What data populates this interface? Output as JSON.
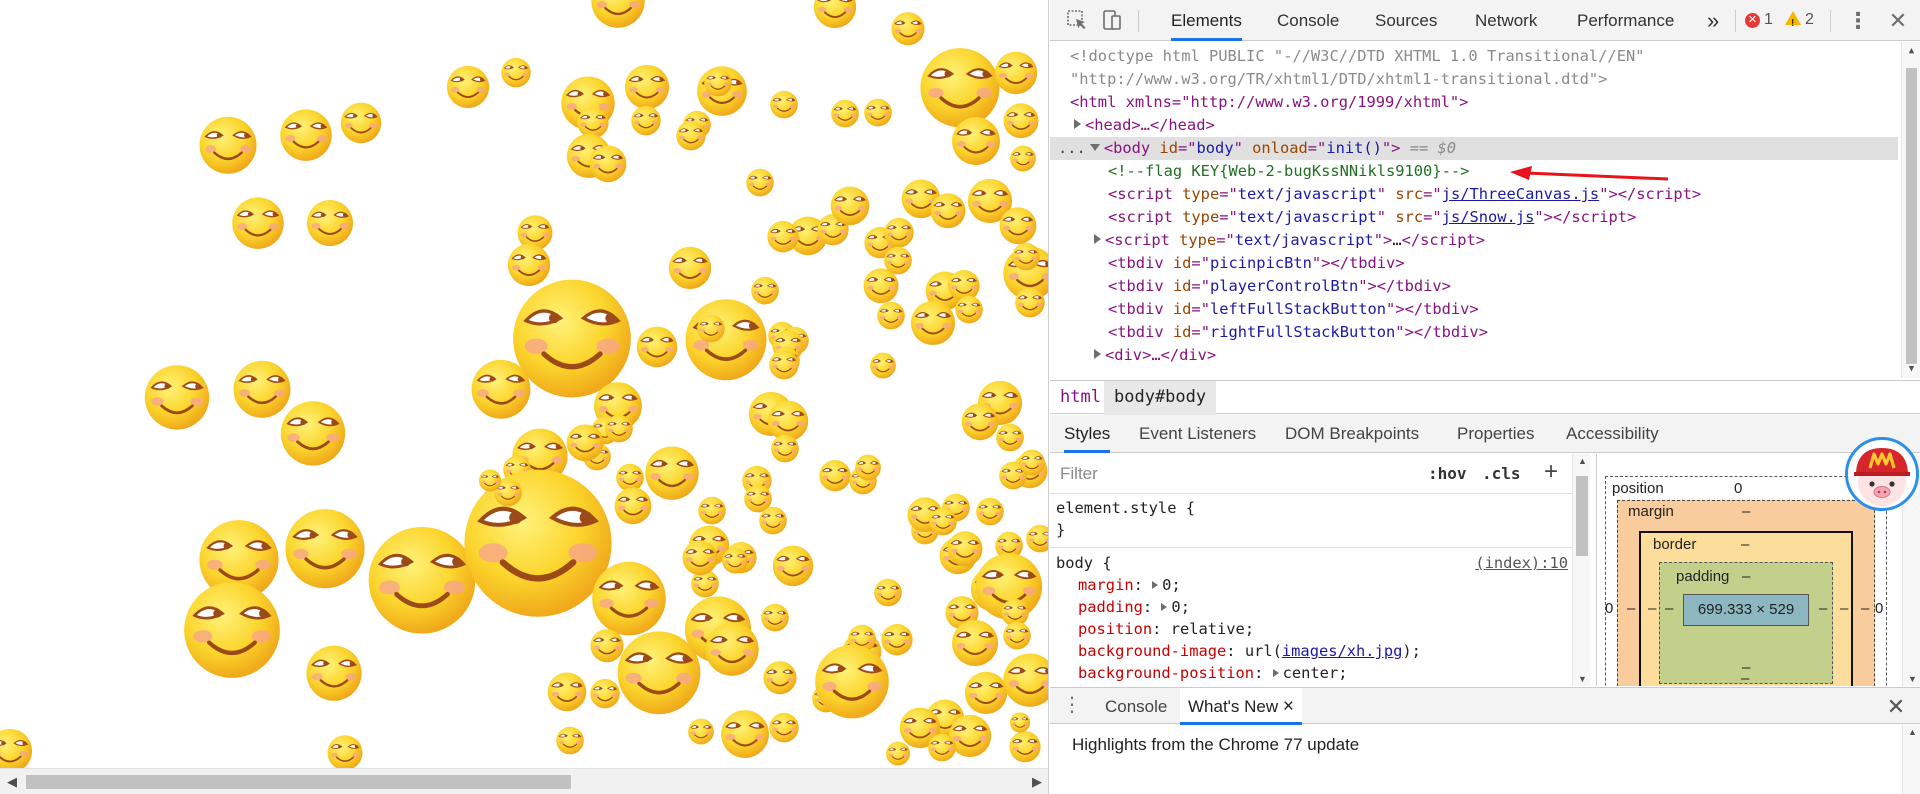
{
  "viewport": {
    "smiley_colors": {
      "face": "#fbd52c",
      "face_edge": "#f0a91b",
      "cheek": "#f7a58a",
      "eye": "#ffffff",
      "line": "#9c4a17"
    }
  },
  "devtools": {
    "toolbar": {
      "inspect_icon": "inspect-element-icon",
      "device_icon": "device-toolbar-icon",
      "tabs": [
        "Elements",
        "Console",
        "Sources",
        "Network",
        "Performance"
      ],
      "more_tabs": "»",
      "error_count": "1",
      "warning_count": "2",
      "menu": "⋮"
    },
    "dom_tree": {
      "doctype_1": "<!doctype html PUBLIC \"-//W3C//DTD XHTML 1.0 Transitional//EN\"",
      "doctype_2": "\"http://www.w3.org/TR/xhtml1/DTD/xhtml1-transitional.dtd\">",
      "html_open": "<html xmlns=\"http://www.w3.org/1999/xhtml\">",
      "head": "<head>…</head>",
      "body_dots": "...",
      "body_id": "body",
      "body_onload": "init()",
      "body_eq": "== $0",
      "comment": "<!--flag KEY{Web-2-bugKssNNikls9100}-->",
      "script_1_src": "js/ThreeCanvas.js",
      "script_2_src": "js/Snow.js",
      "script_type": "text/javascript",
      "script_3": "…",
      "tbdiv_ids": [
        "picinpicBtn",
        "playerControlBtn",
        "leftFullStackButton",
        "rightFullStackButton"
      ],
      "div_collapsed": "<div>…</div>"
    },
    "breadcrumb": [
      "html",
      "body#body"
    ],
    "sub_tabs": [
      "Styles",
      "Event Listeners",
      "DOM Breakpoints",
      "Properties",
      "Accessibility"
    ],
    "styles": {
      "filter_placeholder": "Filter",
      "hov": ":hov",
      "cls": ".cls",
      "new_rule": "+",
      "element_style_open": "element.style {",
      "element_style_close": "}",
      "body_selector": "body {",
      "body_source": "(index):10",
      "props": [
        {
          "name": "margin",
          "value": "0",
          "expandable": true
        },
        {
          "name": "padding",
          "value": "0",
          "expandable": true
        },
        {
          "name": "position",
          "value": "relative",
          "expandable": false
        },
        {
          "name": "background-image",
          "value_prefix": "url(",
          "value_link": "images/xh.jpg",
          "value_suffix": ");"
        },
        {
          "name": "background-position",
          "value": "center",
          "expandable": true
        }
      ]
    },
    "box_model": {
      "position_label": "position",
      "position_value": "0",
      "margin_label": "margin",
      "margin_value": "–",
      "border_label": "border",
      "border_value": "–",
      "padding_label": "padding",
      "padding_value": "–",
      "content": "699.333 × 529",
      "side_zero": "0",
      "dash": "–"
    },
    "drawer": {
      "tabs": [
        "Console",
        "What's New"
      ],
      "close_tab": "×",
      "close": "✕",
      "whats_new": "Highlights from the Chrome 77 update"
    }
  },
  "colors": {
    "accent": "#1a73e8",
    "error": "#e53935",
    "warning": "#f6b300",
    "tag": "#881280",
    "attr": "#994500",
    "value": "#1a1aa6",
    "comment": "#236e25"
  }
}
